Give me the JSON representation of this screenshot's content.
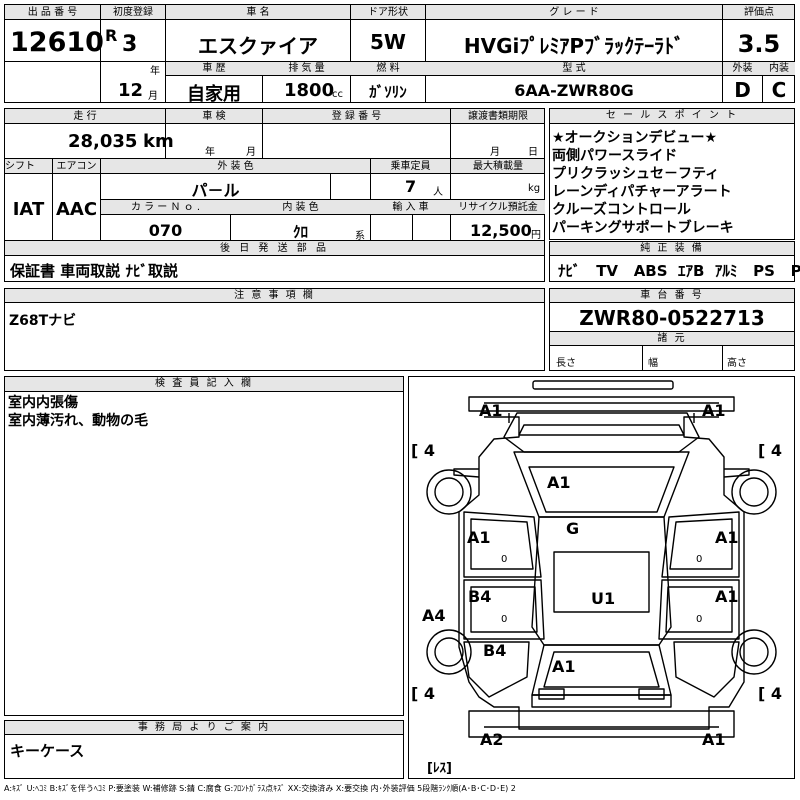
{
  "header": {
    "lot_label": "出 品 番 号",
    "lot": "12610",
    "first_reg_label": "初度登録",
    "era": "R",
    "year": "3",
    "year_unit": "年",
    "month": "12",
    "month_unit": "月",
    "car_name_label": "車 名",
    "car_name": "エスクァイア",
    "door_label": "ドア形状",
    "door": "5W",
    "grade_label": "グ レ ー ド",
    "grade": "HVGiﾌﾟﾚﾐｱPﾌﾞﾗｯｸﾃｰﾗﾄﾞ",
    "score_label": "評価点",
    "score": "3.5",
    "ext_label": "外装",
    "ext": "D",
    "int_label": "内装",
    "int": "C",
    "history_label": "車 歴",
    "history": "自家用",
    "displacement_label": "排 気 量",
    "displacement": "1800",
    "displacement_unit": "cc",
    "fuel_label": "燃 料",
    "fuel": "ｶﾞｿﾘﾝ",
    "model_label": "型 式",
    "model": "6AA-ZWR80G"
  },
  "row2": {
    "mileage_label": "走 行",
    "mileage": "28,035",
    "mileage_unit": "km",
    "inspection_label": "車 検",
    "insp_year_unit": "年",
    "insp_month_unit": "月",
    "reg_label": "登 録 番 号",
    "transfer_label": "譲渡書類期限",
    "transfer_month_unit": "月",
    "transfer_day_unit": "日",
    "shift_label": "シフト",
    "shift": "IAT",
    "ac_label": "エアコン",
    "ac": "AAC",
    "color_label": "外 装 色",
    "color": "パ－ル",
    "capacity_label": "乗車定員",
    "capacity": "7",
    "capacity_unit": "人",
    "load_label": "最大積載量",
    "load_unit": "kg",
    "color_no_label": "カ ラ ー Ｎ ｏ .",
    "color_no": "070",
    "interior_label": "内 装 色",
    "interior": "ｸﾛ",
    "interior_unit": "系",
    "import_label": "輸 入 車",
    "recycle_label": "リサイクル預託金",
    "recycle": "12,500",
    "recycle_unit": "円",
    "later_label": "後 日 発 送 部 品",
    "later": "保証書 車両取説 ﾅﾋﾞ取説"
  },
  "sales": {
    "label": "セ ー ル ス ポ イ ン ト",
    "lines": [
      "★オークションデビュー★",
      "両側パワースライド",
      "プリクラッシュセ－フティ",
      "レーンディパチャーアラート",
      "クルーズコントロール",
      "パーキングサポートブレーキ"
    ]
  },
  "equipment": {
    "label": "純 正 装 備",
    "items": [
      "ﾅﾋﾞ",
      "TV",
      "ABS",
      "ｴｱB",
      "ｱﾙﾐ",
      "PS",
      "PW"
    ]
  },
  "notes": {
    "label": "注 意 事 項 欄",
    "text": "Z68Tナビ"
  },
  "chassis": {
    "label": "車 台 番 号",
    "number": "ZWR80-0522713"
  },
  "dims": {
    "label": "諸 元",
    "length": "長さ",
    "width": "幅",
    "height": "高さ"
  },
  "inspector": {
    "label": "検 査 員 記 入 欄",
    "lines": [
      "室内内張傷",
      "室内薄汚れ、動物の毛"
    ]
  },
  "office": {
    "label": "事 務 局 よ り ご 案 内",
    "text": "キーケース"
  },
  "diagram": {
    "marks": {
      "front_left": "A1",
      "front_right": "A1",
      "hood": "A1",
      "windshield": "G",
      "left_front_door": "A1",
      "right_front_door": "A1",
      "left_rear_door": "B4",
      "right_rear_door": "A1",
      "roof": "U1",
      "left_rocker": "A4",
      "left_quarter": "B4",
      "rear_hatch": "A1",
      "rear_left": "A2",
      "rear_right": "A1"
    },
    "tires": [
      "[ 4",
      "[ 4",
      "[ 4",
      "[ 4"
    ],
    "door_o": "0",
    "spare": "[ﾚｽ]"
  },
  "legend": "A:ｷｽﾞ U:ﾍｺﾐ B:ｷｽﾞを伴うﾍｺﾐ P:要塗装 W:補修跡 S:錆 C:腐食 G:ﾌﾛﾝﾄｶﾞﾗｽ点ｷｽﾞ XX:交換済み X:要交換 内･外装評価 5段階ﾗﾝｸ順(A･B･C･D･E) 2"
}
